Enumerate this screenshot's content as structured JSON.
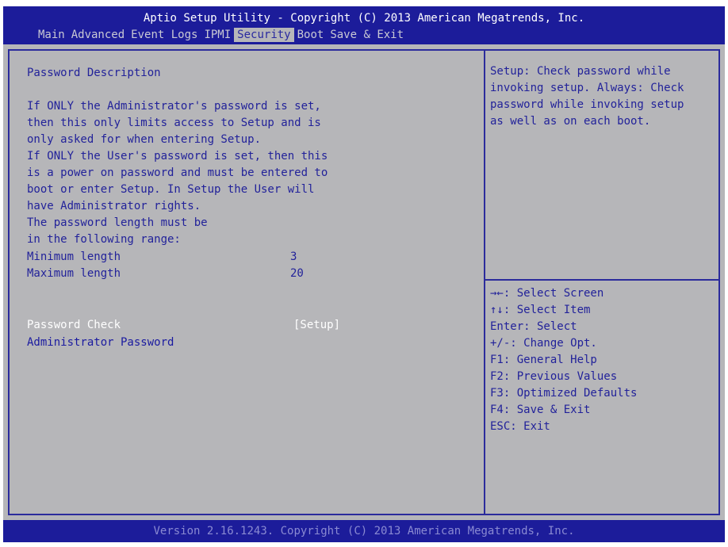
{
  "header": {
    "title": "Aptio Setup Utility - Copyright (C) 2013 American Megatrends, Inc.",
    "tabs": [
      {
        "label": "Main"
      },
      {
        "label": "Advanced"
      },
      {
        "label": "Event Logs"
      },
      {
        "label": "IPMI"
      },
      {
        "label": "Security"
      },
      {
        "label": "Boot"
      },
      {
        "label": "Save & Exit"
      }
    ],
    "active_tab": "Security"
  },
  "main": {
    "description_lines": [
      "Password Description",
      "",
      "If ONLY the Administrator's password is set,",
      "then this only limits access to Setup and is",
      "only asked for when entering Setup.",
      "If ONLY the User's password is set, then this",
      "is a power on password and must be entered to",
      "boot or enter Setup. In Setup the User will",
      "have Administrator rights.",
      "The password length must be",
      "in the following range:"
    ],
    "min_length": {
      "label": "Minimum length",
      "value": "3"
    },
    "max_length": {
      "label": "Maximum length",
      "value": "20"
    },
    "items": [
      {
        "label": "Password Check",
        "value": "[Setup]"
      },
      {
        "label": "Administrator Password",
        "value": ""
      }
    ]
  },
  "help": {
    "description_lines": [
      "Setup: Check password while",
      "invoking setup. Always: Check",
      "password while invoking setup",
      "as well as on each boot."
    ],
    "keys": [
      "→←: Select Screen",
      "↑↓: Select Item",
      "Enter: Select",
      "+/-: Change Opt.",
      "F1: General Help",
      "F2: Previous Values",
      "F3: Optimized Defaults",
      "F4: Save & Exit",
      "ESC: Exit"
    ]
  },
  "footer": {
    "text": "Version 2.16.1243. Copyright (C) 2013 American Megatrends, Inc."
  },
  "colors": {
    "header_bg": "#1c1c9a",
    "panel_bg": "#b6b6b9",
    "text": "#22229a",
    "selected_text": "#ffffff"
  }
}
